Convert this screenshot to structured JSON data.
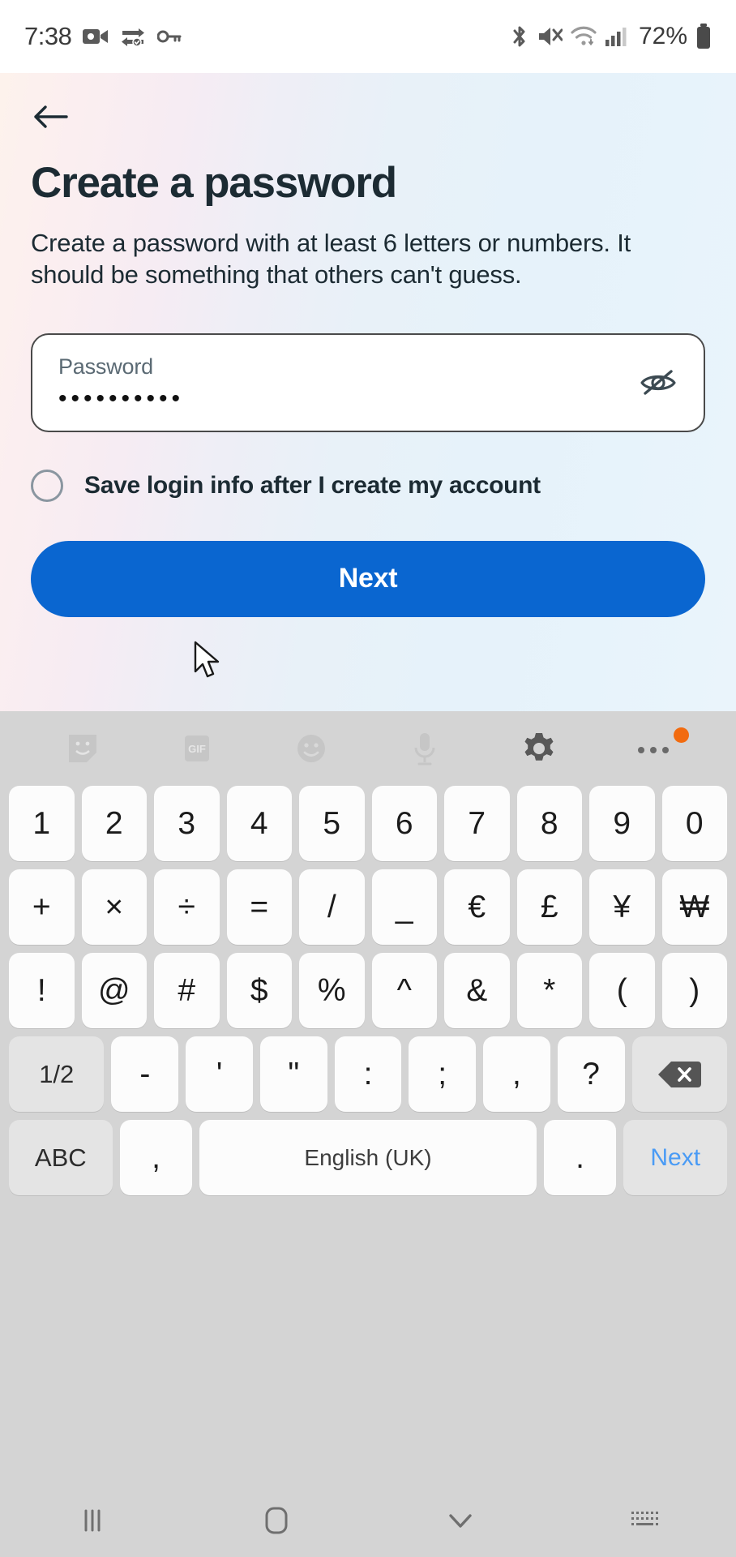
{
  "status_bar": {
    "time": "7:38",
    "battery_percent": "72%",
    "left_icons": [
      "camera-record-icon",
      "vpn-icon",
      "key-icon"
    ],
    "right_icons": [
      "bluetooth-icon",
      "volume-mute-icon",
      "wifi-icon",
      "cellular-signal-icon"
    ]
  },
  "app": {
    "back_icon": "back-arrow-icon",
    "title": "Create a password",
    "subtitle": "Create a password with at least 6 letters or numbers. It should be something that others can't guess.",
    "password_field": {
      "label": "Password",
      "value": "••••••••••",
      "reveal_icon": "eye-slash-icon"
    },
    "save_login": {
      "label": "Save login info after I create my account",
      "checked": false
    },
    "primary_button": {
      "label": "Next",
      "color": "#0a66d0"
    }
  },
  "keyboard": {
    "toolbar": [
      {
        "name": "sticker-icon",
        "label": ""
      },
      {
        "name": "gif-icon",
        "label": "GIF"
      },
      {
        "name": "emoji-icon",
        "label": ""
      },
      {
        "name": "microphone-icon",
        "label": ""
      },
      {
        "name": "settings-gear-icon",
        "label": ""
      },
      {
        "name": "more-options-icon",
        "label": "",
        "badge": true
      }
    ],
    "rows": [
      {
        "keys": [
          {
            "label": "1"
          },
          {
            "label": "2"
          },
          {
            "label": "3"
          },
          {
            "label": "4"
          },
          {
            "label": "5"
          },
          {
            "label": "6"
          },
          {
            "label": "7"
          },
          {
            "label": "8"
          },
          {
            "label": "9"
          },
          {
            "label": "0"
          }
        ]
      },
      {
        "keys": [
          {
            "label": "+"
          },
          {
            "label": "×"
          },
          {
            "label": "÷"
          },
          {
            "label": "="
          },
          {
            "label": "/"
          },
          {
            "label": "_"
          },
          {
            "label": "€"
          },
          {
            "label": "£"
          },
          {
            "label": "¥"
          },
          {
            "label": "₩"
          }
        ]
      },
      {
        "keys": [
          {
            "label": "!"
          },
          {
            "label": "@"
          },
          {
            "label": "#"
          },
          {
            "label": "$"
          },
          {
            "label": "%"
          },
          {
            "label": "^"
          },
          {
            "label": "&"
          },
          {
            "label": "*"
          },
          {
            "label": "("
          },
          {
            "label": ")"
          }
        ]
      },
      {
        "keys": [
          {
            "label": "1/2"
          },
          {
            "label": "-"
          },
          {
            "label": "'"
          },
          {
            "label": "\""
          },
          {
            "label": ":"
          },
          {
            "label": ";"
          },
          {
            "label": ","
          },
          {
            "label": "?"
          },
          {
            "label": ""
          }
        ]
      },
      {
        "keys": [
          {
            "label": "ABC"
          },
          {
            "label": ","
          },
          {
            "label": "English (UK)"
          },
          {
            "label": "."
          },
          {
            "label": "Next"
          }
        ]
      }
    ],
    "language": "English (UK)",
    "symbol_toggle": "1/2",
    "alpha_toggle": "ABC",
    "enter_label": "Next",
    "backspace_icon": "backspace-icon"
  },
  "navbar": {
    "items": [
      {
        "name": "recents-icon"
      },
      {
        "name": "home-icon"
      },
      {
        "name": "hide-keyboard-icon"
      },
      {
        "name": "keyboard-switcher-icon"
      }
    ]
  }
}
